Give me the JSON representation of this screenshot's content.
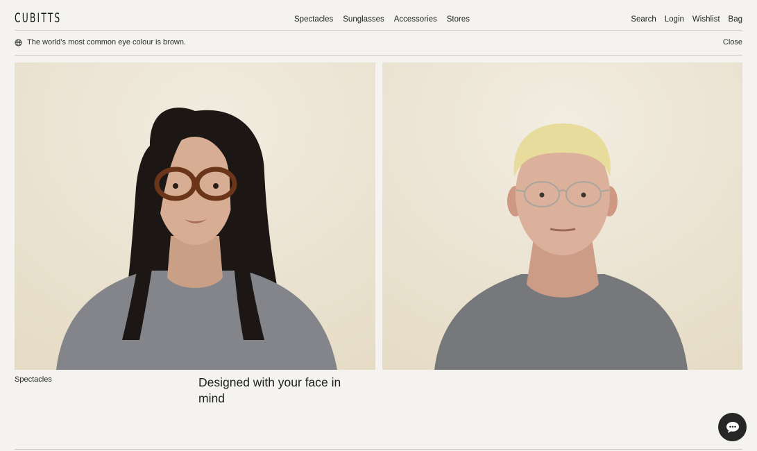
{
  "header": {
    "logo": "CUBITTS",
    "nav_center": [
      "Spectacles",
      "Sunglasses",
      "Accessories",
      "Stores"
    ],
    "nav_right": [
      "Search",
      "Login",
      "Wishlist",
      "Bag"
    ]
  },
  "banner": {
    "icon": "globe-icon",
    "text": "The world’s most common eye colour is brown.",
    "close_label": "Close"
  },
  "hero": {
    "left_image": "woman-tortoiseshell-glasses",
    "right_image": "man-wire-frame-glasses",
    "category_label": "Spectacles",
    "tagline": "Designed with your face in mind"
  },
  "chat": {
    "icon": "chat-bubble-icon"
  },
  "colors": {
    "background": "#f4f3ef",
    "photo_backdrop": "#ede6d6",
    "text": "#1e1e1e",
    "chat_button": "#262626"
  }
}
